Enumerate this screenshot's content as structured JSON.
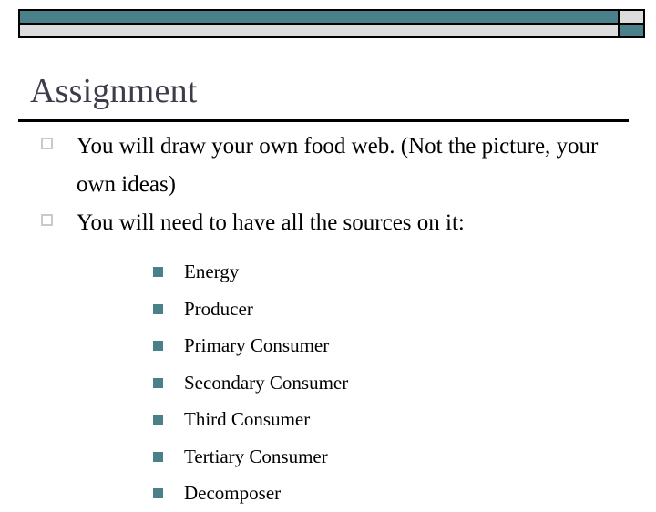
{
  "slide": {
    "title": "Assignment",
    "header_bar": {
      "accent_color": "#4a8089",
      "light_color": "#dcdcdc",
      "border_color": "#000000"
    },
    "rule_color": "#000000",
    "title_color": "#3c3c4c",
    "bullet_marker_color": "#c9c9c9",
    "subbullet_marker_color": "#49808a",
    "bullets": [
      {
        "text": "You will draw your own food web. (Not the picture, your own ideas)",
        "children": []
      },
      {
        "text": "You will need to have all the sources on it:",
        "children": [
          "Energy",
          "Producer",
          "Primary Consumer",
          "Secondary Consumer",
          "Third Consumer",
          "Tertiary Consumer",
          "Decomposer"
        ]
      }
    ]
  }
}
